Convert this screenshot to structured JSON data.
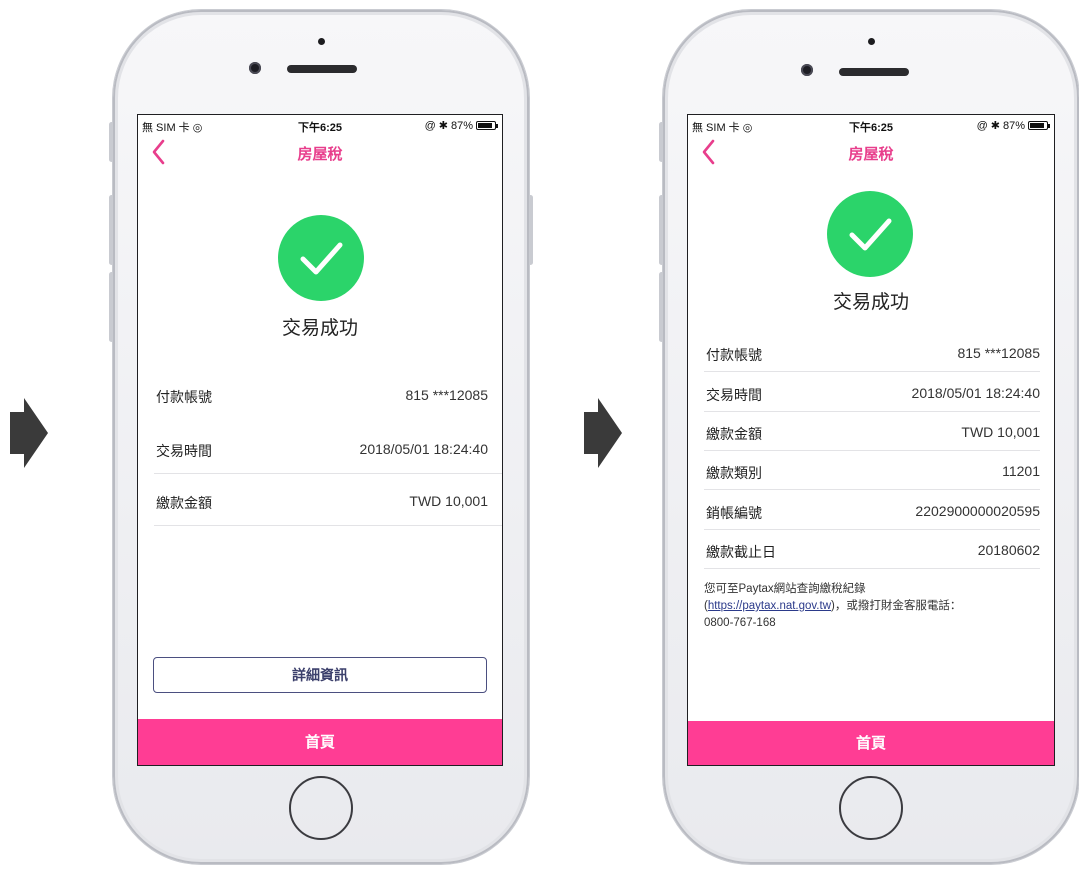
{
  "colors": {
    "accent": "#e83e8c",
    "home_bar": "#ff3d94",
    "success": "#2bd46a"
  },
  "statusbar": {
    "carrier": "無 SIM 卡",
    "time": "下午6:25",
    "battery": "87%"
  },
  "icons": {
    "back": "chevron-left-icon",
    "success": "checkmark-icon",
    "flow_arrow": "right-arrow-icon",
    "wifi": "wifi-icon",
    "bluetooth": "bluetooth-icon",
    "lock": "rotation-lock-icon"
  },
  "screen1": {
    "title": "房屋稅",
    "result": "交易成功",
    "rows": [
      {
        "label": "付款帳號",
        "value": "815 ***12085"
      },
      {
        "label": "交易時間",
        "value": "2018/05/01 18:24:40"
      },
      {
        "label": "繳款金額",
        "value": "TWD 10,001"
      }
    ],
    "detail_button": "詳細資訊",
    "home_button": "首頁"
  },
  "screen2": {
    "title": "房屋稅",
    "result": "交易成功",
    "rows": [
      {
        "label": "付款帳號",
        "value": "815 ***12085"
      },
      {
        "label": "交易時間",
        "value": "2018/05/01 18:24:40"
      },
      {
        "label": "繳款金額",
        "value": "TWD 10,001"
      },
      {
        "label": "繳款類別",
        "value": "11201"
      },
      {
        "label": "銷帳編號",
        "value": "2202900000020595"
      },
      {
        "label": "繳款截止日",
        "value": "20180602"
      }
    ],
    "note_line1": "您可至Paytax網站查詢繳稅紀錄",
    "note_link": "https://paytax.nat.gov.tw",
    "note_line2_suffix": "，或撥打財金客服電話：",
    "note_line3": "0800-767-168",
    "home_button": "首頁"
  }
}
